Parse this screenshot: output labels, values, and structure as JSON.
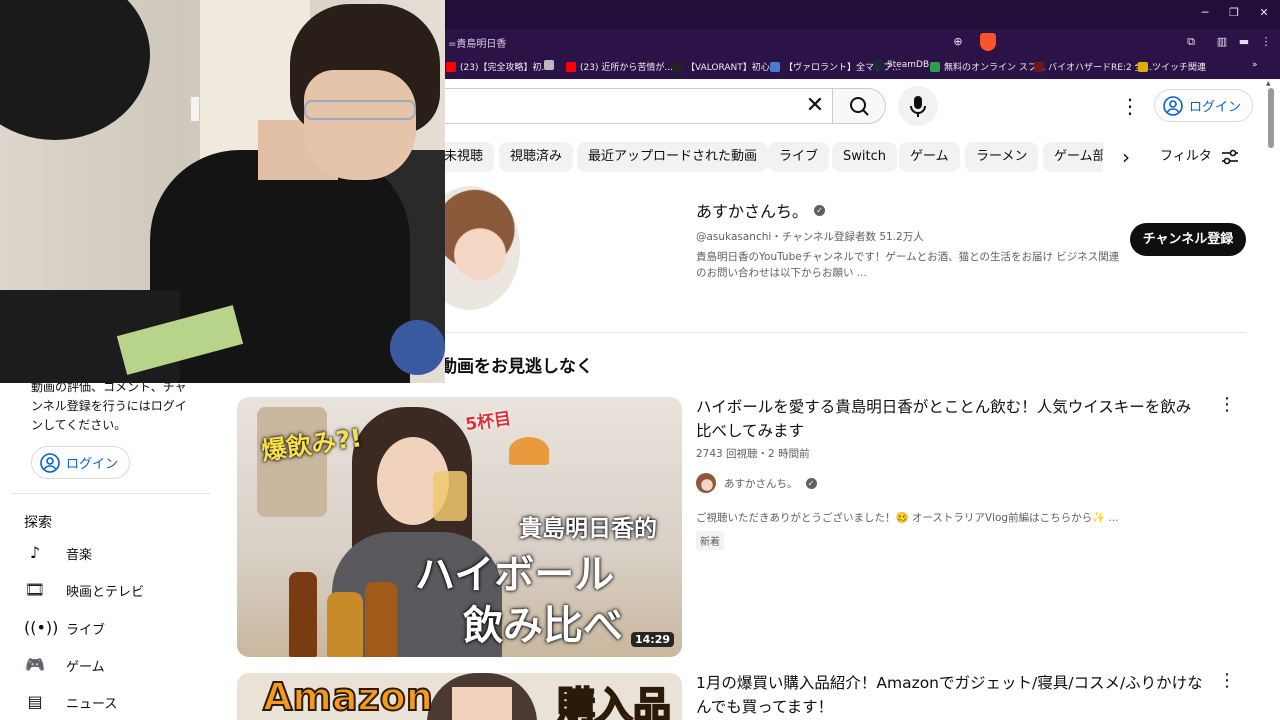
{
  "browser": {
    "address": "=貴島明日香",
    "window_controls": [
      "─",
      "❐",
      "✕"
    ],
    "bookmarks": [
      {
        "label": "(23)【完全攻略】初...",
        "color": "#ff0000"
      },
      {
        "label": "",
        "color": "#bbbbbb"
      },
      {
        "label": "(23) 近所から苦情が...",
        "color": "#ff0000"
      },
      {
        "label": "【VALORANT】初心...",
        "color": "#222222"
      },
      {
        "label": "【ヴァロラント】全マップ...",
        "color": "#4a7bd0"
      },
      {
        "label": "SteamDB",
        "color": "#1b2838"
      },
      {
        "label": "無料のオンライン スプ...",
        "color": "#2e9e4a"
      },
      {
        "label": "バイオハザードRE:2 全...",
        "color": "#6a1a1a"
      },
      {
        "label": "ツイッチ関連",
        "color": "#e0b000"
      }
    ],
    "bookmarks_overflow": "»"
  },
  "header": {
    "login_label": "ログイン"
  },
  "chips": [
    "未視聴",
    "視聴済み",
    "最近アップロードされた動画",
    "ライブ",
    "Switch",
    "ゲーム",
    "ラーメン",
    "ゲーム部"
  ],
  "filter_label": "フィルタ",
  "channel": {
    "name": "あすかさんち。",
    "meta": "@asukasanchi・チャンネル登録者数 51.2万人",
    "description": "貴島明日香のYouTubeチャンネルです！ゲームとお酒、猫との生活をお届け ビジネス関連のお問い合わせは以下からお願い ...",
    "subscribe_label": "チャンネル登録"
  },
  "section_title": "動画をお見逃しなく",
  "sidebar": {
    "message": "動画の評価、コメント、チャンネル登録を行うにはログインしてください。",
    "login_label": "ログイン",
    "explore_heading": "探索",
    "items": [
      {
        "label": "音楽",
        "icon": "music-note-icon"
      },
      {
        "label": "映画とテレビ",
        "icon": "film-icon"
      },
      {
        "label": "ライブ",
        "icon": "live-icon"
      },
      {
        "label": "ゲーム",
        "icon": "gamepad-icon"
      },
      {
        "label": "ニュース",
        "icon": "news-icon"
      }
    ]
  },
  "videos": [
    {
      "title": "ハイボールを愛する貴島明日香がとことん飲む！人気ウイスキーを飲み比べしてみます",
      "meta": "2743 回視聴・2 時間前",
      "channel": "あすかさんち。",
      "description": "ご視聴いただきありがとうございました！🥴 オーストラリアVlog前編はこちらから✨ ...",
      "badge": "新着",
      "duration": "14:29",
      "thumb_text": {
        "top_left": "爆飲み?!",
        "arrow_label": "5杯目",
        "line1": "貴島明日香的",
        "line2": "ハイボール",
        "line3": "飲み比べ"
      }
    },
    {
      "title": "1月の爆買い購入品紹介！Amazonでガジェット/寝具/コスメ/ふりかけなんでも買ってます！",
      "thumb_text": {
        "left": "Amazon",
        "right": "購入品"
      }
    }
  ]
}
